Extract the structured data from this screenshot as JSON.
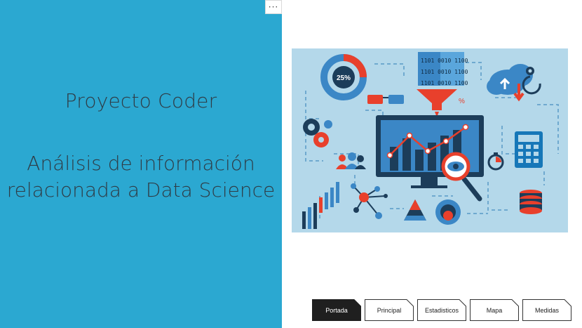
{
  "report": {
    "title": "Proyecto Coder",
    "subtitle_line1": "Análisis de información",
    "subtitle_line2": "relacionada a Data Science",
    "more_options": "···"
  },
  "illustration": {
    "gauge_label": "25%",
    "binary_lines": [
      "1101  0010  1100",
      "1101  0010  1100",
      "1101  0010  1100"
    ],
    "percent_symbol": "%"
  },
  "tabs": [
    {
      "label": "Portada",
      "active": true
    },
    {
      "label": "Principal",
      "active": false
    },
    {
      "label": "Estadisticos",
      "active": false
    },
    {
      "label": "Mapa",
      "active": false
    },
    {
      "label": "Medidas",
      "active": false
    }
  ],
  "colors": {
    "panel_bg": "#2ba8d1",
    "title_text": "#2f3b45",
    "illustration_bg": "#b4d8ea",
    "active_tab": "#1f1f1f",
    "accent_red": "#e8402c",
    "accent_blue": "#1677b8",
    "navy": "#1c3d5a"
  }
}
